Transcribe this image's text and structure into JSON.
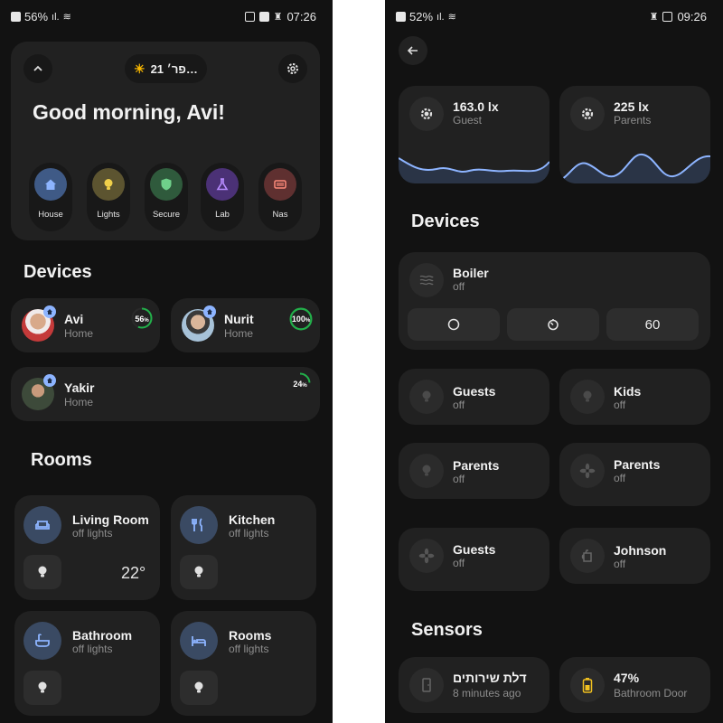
{
  "left": {
    "status": {
      "battery": "56%",
      "time": "07:26"
    },
    "header": {
      "weather": "פר׳ 21…"
    },
    "greeting": "Good morning, Avi!",
    "quick_actions": [
      {
        "label": "House",
        "icon": "house-icon",
        "color": "#3f5a86",
        "accent": "#8db4ff"
      },
      {
        "label": "Lights",
        "icon": "bulb-icon",
        "color": "#5c5430",
        "accent": "#f0d04a"
      },
      {
        "label": "Secure",
        "icon": "shield-icon",
        "color": "#2f5a3c",
        "accent": "#6fd08a"
      },
      {
        "label": "Lab",
        "icon": "flask-icon",
        "color": "#4b3176",
        "accent": "#b88cff"
      },
      {
        "label": "Nas",
        "icon": "server-icon",
        "color": "#5f3030",
        "accent": "#ff8a7a"
      }
    ],
    "devices_title": "Devices",
    "people": [
      {
        "name": "Avi",
        "status": "Home",
        "battery": "56",
        "battery_unit": "%",
        "level": 0.56
      },
      {
        "name": "Nurit",
        "status": "Home",
        "battery": "100",
        "battery_unit": "%",
        "level": 1.0
      },
      {
        "name": "Yakir",
        "status": "Home",
        "battery": "24",
        "battery_unit": "%",
        "level": 0.24
      }
    ],
    "rooms_title": "Rooms",
    "rooms": [
      {
        "name": "Living Room",
        "status": "off lights",
        "icon": "sofa-icon",
        "temp": "22°"
      },
      {
        "name": "Kitchen",
        "status": "off lights",
        "icon": "fork-knife-icon"
      },
      {
        "name": "Bathroom",
        "status": "off lights",
        "icon": "bathtub-icon"
      },
      {
        "name": "Rooms",
        "status": "off lights",
        "icon": "bed-icon"
      }
    ]
  },
  "right": {
    "status": {
      "battery": "52%",
      "time": "09:26"
    },
    "lux": [
      {
        "value": "163.0 lx",
        "label": "Guest"
      },
      {
        "value": "225 lx",
        "label": "Parents"
      }
    ],
    "devices_title": "Devices",
    "boiler": {
      "name": "Boiler",
      "status": "off",
      "timer": "60"
    },
    "devices": [
      {
        "name": "Guests",
        "status": "off",
        "icon": "bulb-icon"
      },
      {
        "name": "Kids",
        "status": "off",
        "icon": "bulb-icon"
      },
      {
        "name": "Parents",
        "status": "off",
        "icon": "bulb-icon"
      },
      {
        "name": "Parents",
        "status": "off",
        "icon": "fan-icon"
      },
      {
        "name": "Guests",
        "status": "off",
        "icon": "fan-icon"
      },
      {
        "name": "Johnson",
        "status": "off",
        "icon": "kettle-icon"
      }
    ],
    "sensors_title": "Sensors",
    "sensors": [
      {
        "name": "דלת שירותים",
        "status": "8 minutes ago",
        "icon": "door-icon"
      },
      {
        "name": "47%",
        "status": "Bathroom Door",
        "icon": "battery-icon"
      }
    ]
  }
}
